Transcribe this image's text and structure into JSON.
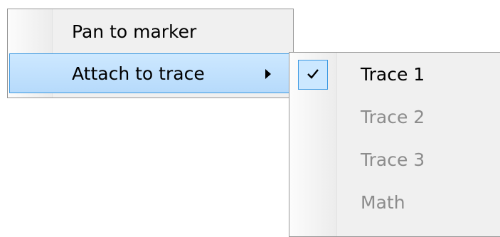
{
  "context_menu": {
    "items": [
      {
        "label": "Pan to marker"
      },
      {
        "label": "Attach to trace",
        "has_submenu": true,
        "highlighted": true
      }
    ]
  },
  "submenu": {
    "items": [
      {
        "label": "Trace 1",
        "checked": true,
        "enabled": true
      },
      {
        "label": "Trace 2",
        "checked": false,
        "enabled": false
      },
      {
        "label": "Trace 3",
        "checked": false,
        "enabled": false
      },
      {
        "label": "Math",
        "checked": false,
        "enabled": false
      }
    ]
  },
  "colors": {
    "menu_background": "#f0f0f0",
    "highlight_fill": "#cde8ff",
    "highlight_border": "#3c99e2",
    "disabled_text": "#8c8c8c"
  },
  "icons": {
    "submenu_arrow": "triangle-right-icon",
    "check": "check-icon"
  }
}
